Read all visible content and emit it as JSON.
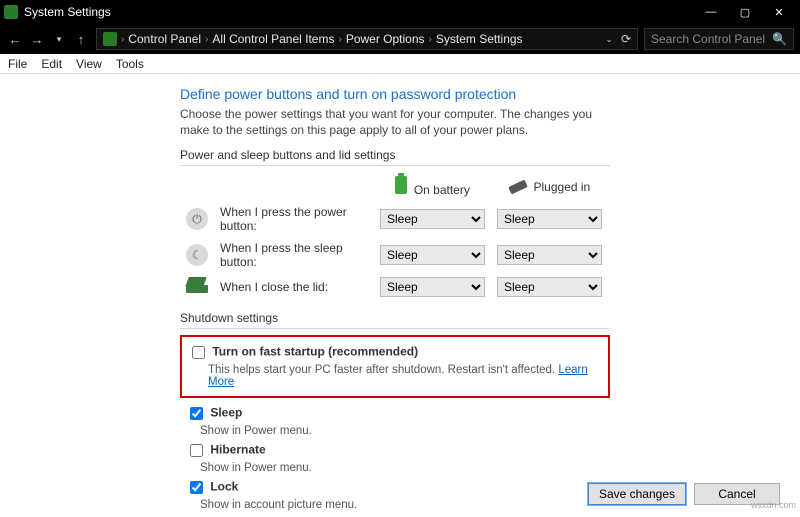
{
  "window": {
    "title": "System Settings"
  },
  "breadcrumbs": {
    "items": [
      "Control Panel",
      "All Control Panel Items",
      "Power Options",
      "System Settings"
    ]
  },
  "search": {
    "placeholder": "Search Control Panel"
  },
  "menu": {
    "file": "File",
    "edit": "Edit",
    "view": "View",
    "tools": "Tools"
  },
  "page": {
    "title": "Define power buttons and turn on password protection",
    "intro": "Choose the power settings that you want for your computer. The changes you make to the settings on this page apply to all of your power plans."
  },
  "power_section": {
    "head": "Power and sleep buttons and lid settings",
    "cols": {
      "battery": "On battery",
      "plugged": "Plugged in"
    },
    "rows": {
      "power_btn": {
        "label": "When I press the power button:",
        "battery": "Sleep",
        "plugged": "Sleep"
      },
      "sleep_btn": {
        "label": "When I press the sleep button:",
        "battery": "Sleep",
        "plugged": "Sleep"
      },
      "lid": {
        "label": "When I close the lid:",
        "battery": "Sleep",
        "plugged": "Sleep"
      }
    }
  },
  "shutdown_section": {
    "head": "Shutdown settings",
    "fast_startup": {
      "title": "Turn on fast startup (recommended)",
      "desc": "This helps start your PC faster after shutdown. Restart isn't affected.",
      "link": "Learn More",
      "checked": false
    },
    "sleep": {
      "title": "Sleep",
      "desc": "Show in Power menu.",
      "checked": true
    },
    "hibernate": {
      "title": "Hibernate",
      "desc": "Show in Power menu.",
      "checked": false
    },
    "lock": {
      "title": "Lock",
      "desc": "Show in account picture menu.",
      "checked": true
    }
  },
  "buttons": {
    "save": "Save changes",
    "cancel": "Cancel"
  },
  "watermark": "wsxdn.com"
}
